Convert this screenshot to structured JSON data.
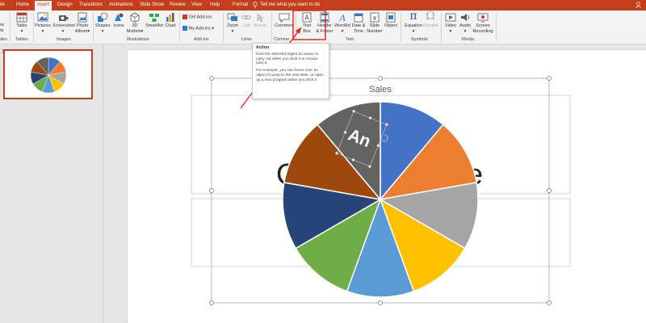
{
  "tabs": [
    "ile",
    "Home",
    "Insert",
    "Design",
    "Transitions",
    "Animations",
    "Slide Show",
    "Review",
    "View",
    "Help",
    "Format"
  ],
  "active_tab": "Insert",
  "tell_me": "Tell me what you want to do",
  "ribbon": {
    "new_slide": [
      "lew",
      "ide"
    ],
    "slides_group": "des",
    "table": "Table",
    "tables_group": "Tables",
    "pictures": "Pictures",
    "screenshot": "Screenshot",
    "photo_album": [
      "Photo",
      "Album"
    ],
    "images_group": "Images",
    "shapes": "Shapes",
    "icons": "Icons",
    "models_3d": [
      "3D",
      "Models"
    ],
    "smartart": "SmartArt",
    "chart": "Chart",
    "illustrations_group": "Illustrations",
    "get_addins": "Get Add-ins",
    "my_addins": "My Add-ins",
    "addins_group": "Add-ins",
    "zoom": "Zoom",
    "link": "Link",
    "action": "Action",
    "links_group": "Links",
    "comment": "Comment",
    "comments_group": "Comme",
    "text_box": [
      "Text",
      "Box"
    ],
    "header_footer": [
      "Header",
      "& Footer"
    ],
    "wordart": "WordArt",
    "date_time": [
      "Date &",
      "Time"
    ],
    "slide_number": [
      "Slide",
      "Number"
    ],
    "object": "Object",
    "text_group": "Text",
    "equation": "Equation",
    "symbol": "Symbol",
    "symbols_group": "Symbols",
    "video": "Video",
    "audio": "Audio",
    "screen_recording": [
      "Screen",
      "Recording"
    ],
    "media_group": "Media"
  },
  "thumbnail_number": "1",
  "tooltip": {
    "title": "Action",
    "p1": "Give the selected object an action to carry out when you click it or mouse over it.",
    "p2": "For example, you can hover over an object to jump to the next slide, or open up a new program when you click it."
  },
  "slide": {
    "bg_title_fragment_left": "C",
    "bg_title_fragment_right": "e",
    "wordart_text": "An"
  },
  "chart_data": {
    "type": "pie",
    "title": "Sales",
    "values": [
      1,
      1,
      1,
      1,
      1,
      1,
      1,
      1,
      1,
      1
    ],
    "colors": [
      "#4472c4",
      "#ed7d31",
      "#a5a5a5",
      "#ffc000",
      "#5b9bd5",
      "#70ad47",
      "#264478",
      "#9e480e",
      "#636363",
      "#997300"
    ],
    "slice_colors_order": [
      "#4472c4",
      "#ed7d31",
      "#a5a5a5",
      "#ffc000",
      "#5b9bd5",
      "#70ad47",
      "#264478",
      "#9e480e",
      "#636363"
    ]
  },
  "colors": {
    "accent": "#c43e1c",
    "annotation": "#e0201b"
  }
}
